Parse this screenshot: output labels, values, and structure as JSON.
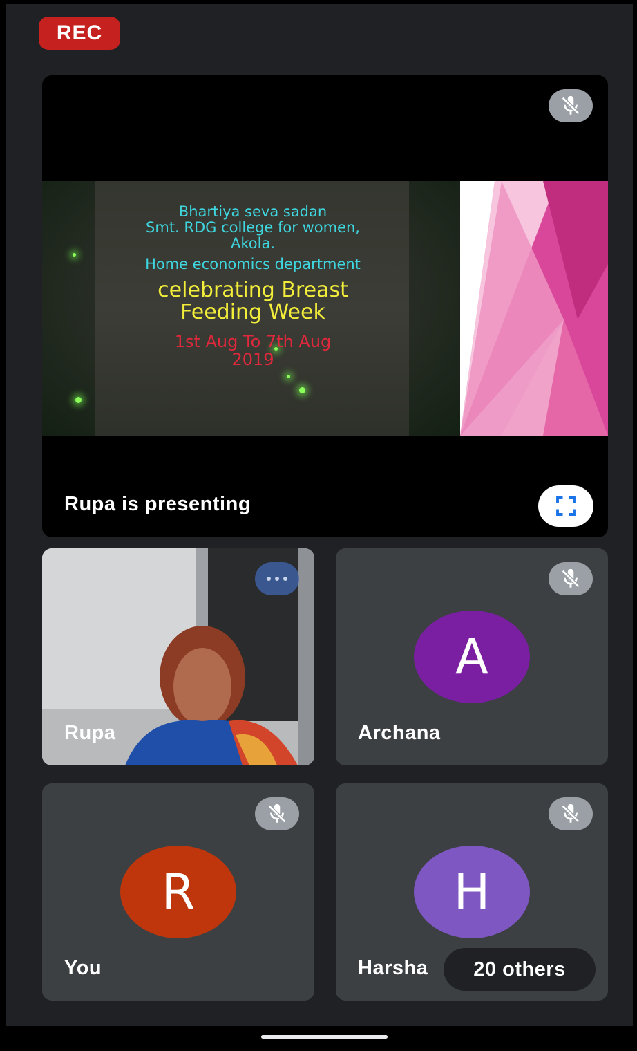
{
  "recording": {
    "label": "REC"
  },
  "presentation": {
    "status_text": "Rupa is presenting",
    "slide": {
      "lines": [
        "Bhartiya seva sadan",
        "Smt. RDG college for women,",
        "Akola.",
        "Home economics department",
        "celebrating Breast",
        "Feeding Week",
        "1st Aug To 7th Aug",
        "2019"
      ]
    },
    "mic_icon": "mic-off-icon",
    "fullscreen_icon": "fullscreen-icon"
  },
  "participants": [
    {
      "name": "Rupa",
      "kind": "video",
      "icon": "more-options-icon"
    },
    {
      "name": "Archana",
      "kind": "avatar",
      "initial": "A",
      "color": "#7b1fa2",
      "icon": "mic-off-icon"
    },
    {
      "name": "You",
      "kind": "avatar",
      "initial": "R",
      "color": "#bf360c",
      "icon": "mic-off-icon"
    },
    {
      "name": "Harsha",
      "kind": "avatar",
      "initial": "H",
      "color": "#7e57c2",
      "icon": "mic-off-icon"
    }
  ],
  "others": {
    "label": "20 others"
  },
  "colors": {
    "background": "#202124",
    "tile": "#3c4043",
    "rec": "#c5221f",
    "accent": "#1a73e8"
  }
}
